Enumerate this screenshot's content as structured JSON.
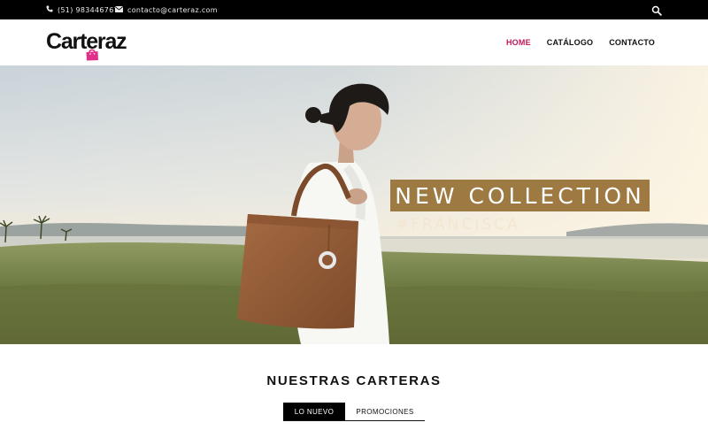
{
  "topbar": {
    "phone": "(51) 983446767",
    "email": "contacto@carteraz.com",
    "phone_icon": "phone-icon",
    "email_icon": "envelope-icon",
    "search_icon": "search-icon"
  },
  "header": {
    "logo_text": "Carteraz",
    "logo_icon": "shopping-bag-icon",
    "nav": [
      {
        "label": "HOME",
        "active": true
      },
      {
        "label": "CATÁLOGO",
        "active": false
      },
      {
        "label": "CONTACTO",
        "active": false
      }
    ]
  },
  "hero": {
    "title": "NEW COLLECTION",
    "subtitle": "#FRANCISCA"
  },
  "section": {
    "title": "NUESTRAS CARTERAS",
    "tabs": [
      {
        "label": "LO NUEVO",
        "active": true
      },
      {
        "label": "PROMOCIONES",
        "active": false
      }
    ]
  },
  "colors": {
    "accent": "#c2185b",
    "banner": "#967034",
    "topbar": "#000000"
  }
}
